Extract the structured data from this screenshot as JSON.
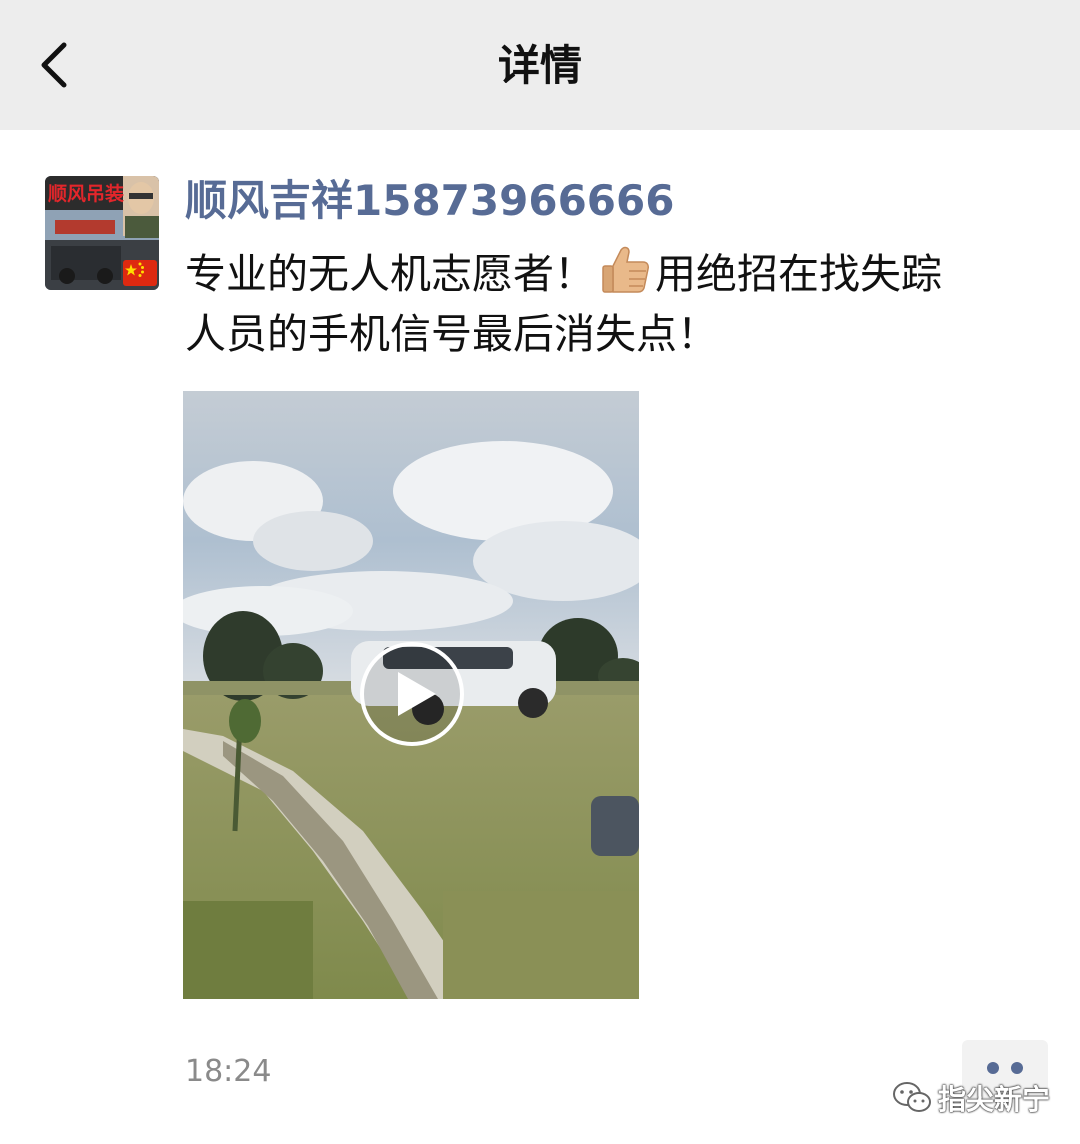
{
  "header": {
    "title": "详情",
    "back_icon": "chevron-left-icon"
  },
  "post": {
    "author": "顺风吉祥15873966666",
    "avatar": {
      "sign_text": "顺风吊装",
      "flag_icon": "china-flag-icon"
    },
    "text_line_1a": "专业的无人机志愿者！",
    "text_line_1b": "用绝招在找失踪",
    "text_line_2": "人员的手机信号最后消失点！",
    "emoji": "thumbs-up-icon",
    "video": {
      "play_icon": "play-icon"
    },
    "time": "18:24",
    "more_icon": "more-dots-icon"
  },
  "watermark": {
    "text": "指尖新宁",
    "icon": "wechat-icon"
  },
  "colors": {
    "topbar": "#ededed",
    "author": "#576b95",
    "timestamp": "#8a8a8a"
  }
}
